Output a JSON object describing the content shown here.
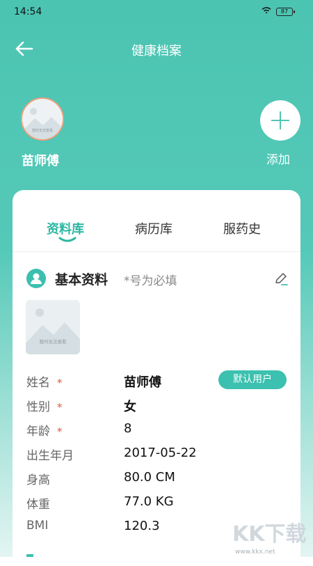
{
  "status_bar": {
    "time": "14:54",
    "battery": "87"
  },
  "navbar": {
    "title": "健康档案"
  },
  "profile": {
    "name": "苗师傅",
    "avatar_caption": "暂时无法查看"
  },
  "add": {
    "label": "添加"
  },
  "tabs": [
    {
      "label": "资料库",
      "active": true
    },
    {
      "label": "病历库",
      "active": false
    },
    {
      "label": "服药史",
      "active": false
    }
  ],
  "section": {
    "title": "基本资料",
    "hint": "*号为必填",
    "photo_caption": "暂时无法查看"
  },
  "fields": [
    {
      "label": "姓名",
      "required": "*",
      "value": "苗师傅",
      "badge": "默认用户"
    },
    {
      "label": "性别",
      "required": "*",
      "value": "女"
    },
    {
      "label": "年龄",
      "required": "*",
      "value": "8"
    },
    {
      "label": "出生年月",
      "value": "2017-05-22"
    },
    {
      "label": "身高",
      "value": "80.0 CM"
    },
    {
      "label": "体重",
      "value": "77.0 KG"
    },
    {
      "label": "BMI",
      "value": "120.3"
    }
  ],
  "watermark": {
    "text": "KK下载",
    "url": "www.kkx.net"
  },
  "colors": {
    "accent": "#3cc0af",
    "header": "#4cc4b2"
  }
}
